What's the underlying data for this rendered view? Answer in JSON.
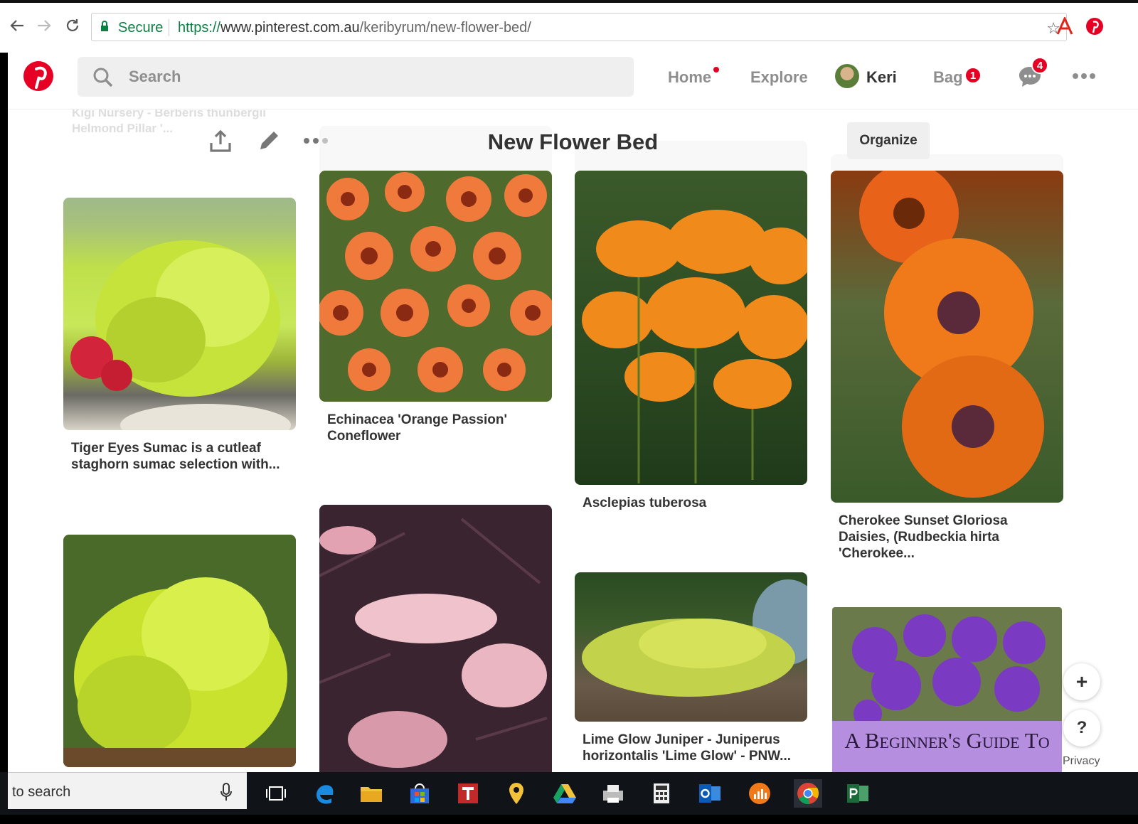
{
  "browser": {
    "secure_label": "Secure",
    "url_scheme": "https://",
    "url_host": "www.pinterest.com.au",
    "url_path": "/keribyrum/new-flower-bed/"
  },
  "header": {
    "search_placeholder": "Search",
    "nav": {
      "home": "Home",
      "explore": "Explore",
      "user": "Keri",
      "bag": "Bag",
      "bag_count": "1",
      "messages_count": "4"
    }
  },
  "board": {
    "ghost_text_1": "Kigi Nursery - Berberis thunbergii",
    "ghost_text_2": "Helmond Pillar '...",
    "title": "New Flower Bed",
    "organize_label": "Organize"
  },
  "pins": [
    {
      "caption": "Tiger Eyes Sumac is a cutleaf staghorn sumac selection with...",
      "image": "lime-green-sumac-shrub"
    },
    {
      "caption": "Echinacea 'Orange Passion' Coneflower",
      "image": "orange-coneflowers"
    },
    {
      "caption": "Asclepias tuberosa",
      "image": "orange-butterfly-weed"
    },
    {
      "caption": "Cherokee Sunset Gloriosa Daisies, (Rudbeckia hirta 'Cherokee...",
      "image": "orange-rudbeckia-daisies"
    },
    {
      "caption": "",
      "image": "yellow-green-sumac"
    },
    {
      "caption": "",
      "image": "dark-purple-elderberry-pink-flowers"
    },
    {
      "caption": "Lime Glow Juniper - Juniperus horizontalis 'Lime Glow' - PNW...",
      "image": "lime-juniper"
    },
    {
      "caption": "A Beginner's Guide To",
      "image": "purple-allium"
    }
  ],
  "floating": {
    "plus": "+",
    "help": "?",
    "privacy": "Privacy"
  },
  "taskbar": {
    "search_text": "to search"
  }
}
